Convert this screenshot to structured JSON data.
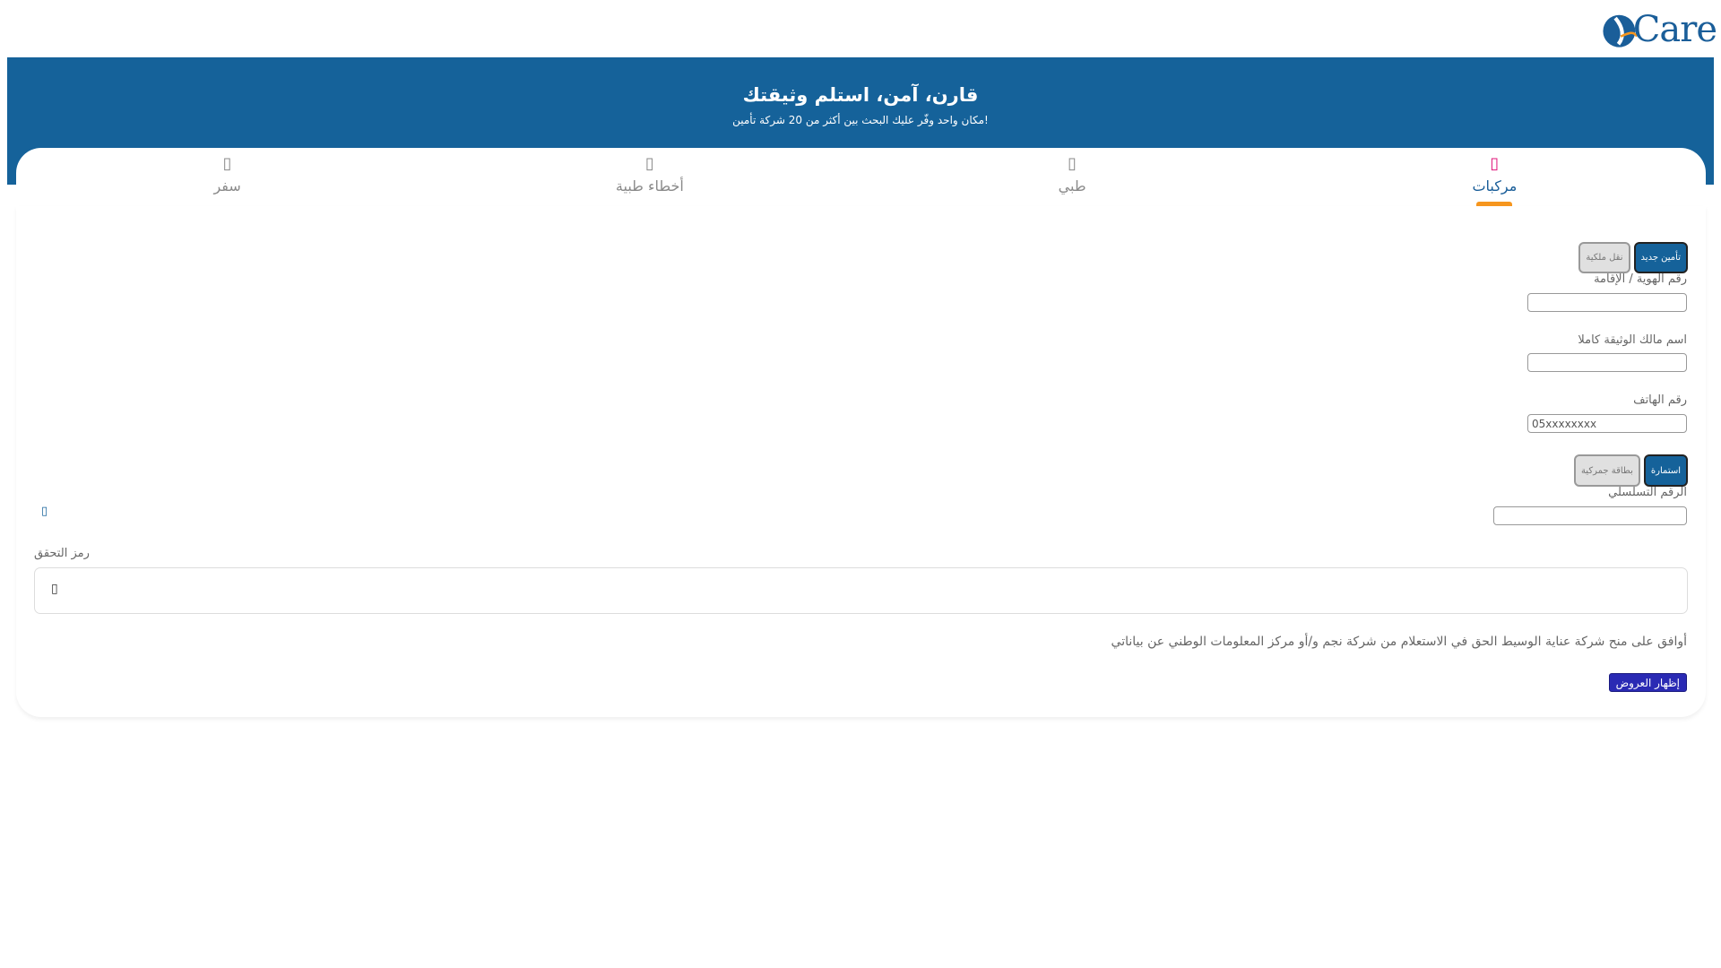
{
  "logo": {
    "text": "Care",
    "mark_icon": "care-logo-mark-icon"
  },
  "banner": {
    "title": "قارن، آمن، استلم وثيقتك",
    "subtitle": "مكان واحد وفّر عليك البحث بين أكثر من 20 شركة تأمين!"
  },
  "tabs": [
    {
      "label": "مركبات",
      "icon": "car-icon",
      "glyph": "▯",
      "active": true
    },
    {
      "label": "طبي",
      "icon": "medical-icon",
      "glyph": "▯",
      "active": false
    },
    {
      "label": "أخطاء طبية",
      "icon": "medical-error-icon",
      "glyph": "▯",
      "active": false
    },
    {
      "label": "سفر",
      "icon": "travel-icon",
      "glyph": "▯",
      "active": false
    }
  ],
  "form": {
    "insurance_type": {
      "new": "تأمين جديد",
      "transfer": "نقل ملكية",
      "selected": "new"
    },
    "id_label": "رقم الهوية / الإقامة",
    "id_value": "",
    "owner_label": "اسم مالك الوثيقة كاملا",
    "owner_value": "",
    "phone_label": "رقم الهاتف",
    "phone_placeholder": "05xxxxxxxx",
    "doc_type": {
      "registration": "استمارة",
      "customs": "بطاقة جمركية",
      "selected": "registration"
    },
    "serial_label": "الرقم التسلسلي",
    "serial_value": "",
    "refresh_glyph": "▯",
    "captcha_label": "رمز التحقق",
    "captcha_glyph": "▯",
    "consent_text": "أوافق على منح شركة عناية الوسيط الحق في الاستعلام من شركة نجم و/أو مركز المعلومات الوطني عن بياناتي",
    "submit_label": "إظهار العروض"
  },
  "colors": {
    "brand_blue": "#15629a",
    "active_tab_icon": "#e0157a",
    "tab_underline": "#f6961e",
    "submit_button": "#2a2ab4"
  }
}
